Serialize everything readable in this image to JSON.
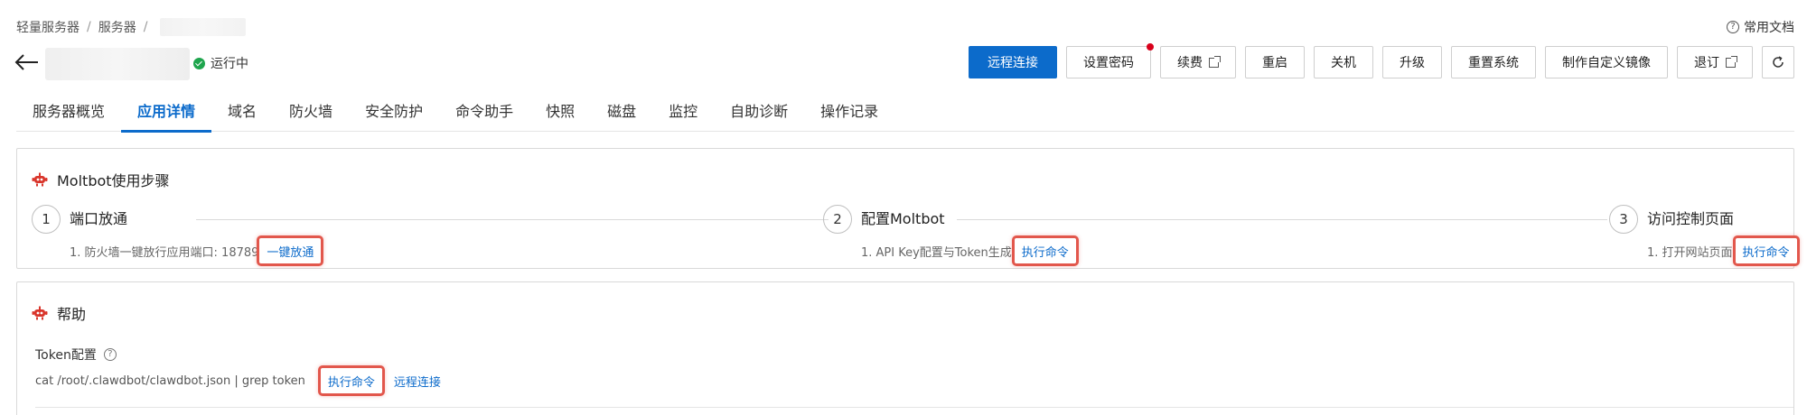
{
  "breadcrumb": {
    "items": [
      "轻量服务器",
      "服务器"
    ],
    "separator": "/"
  },
  "docs": {
    "label": "常用文档"
  },
  "status": {
    "label": "运行中",
    "color": "#1ea54d"
  },
  "actions": {
    "remote": "远程连接",
    "set_password": "设置密码",
    "renew": "续费",
    "restart": "重启",
    "shutdown": "关机",
    "upgrade": "升级",
    "reset_system": "重置系统",
    "custom_image": "制作自定义镜像",
    "refund": "退订"
  },
  "tabs": [
    "服务器概览",
    "应用详情",
    "域名",
    "防火墙",
    "安全防护",
    "命令助手",
    "快照",
    "磁盘",
    "监控",
    "自助诊断",
    "操作记录"
  ],
  "active_tab": "应用详情",
  "steps_card": {
    "title": "Moltbot使用步骤",
    "steps": [
      {
        "num": "1",
        "title": "端口放通",
        "desc": "1. 防火墙一键放行应用端口: 18789",
        "action": "一键放通"
      },
      {
        "num": "2",
        "title": "配置Moltbot",
        "desc": "1. API Key配置与Token生成",
        "action": "执行命令"
      },
      {
        "num": "3",
        "title": "访问控制页面",
        "desc": "1. 打开网站页面",
        "action": "执行命令"
      }
    ]
  },
  "help_card": {
    "title": "帮助",
    "token_label": "Token配置",
    "command": "cat /root/.clawdbot/clawdbot.json | grep token",
    "execute": "执行命令",
    "remote": "远程连接"
  },
  "colors": {
    "primary": "#0c6bcb",
    "highlight": "#e2574c",
    "notify": "#d9001b"
  },
  "icons": [
    "back-arrow-icon",
    "check-circle-icon",
    "help-circle-icon",
    "external-link-icon",
    "refresh-icon",
    "moltbot-icon"
  ]
}
